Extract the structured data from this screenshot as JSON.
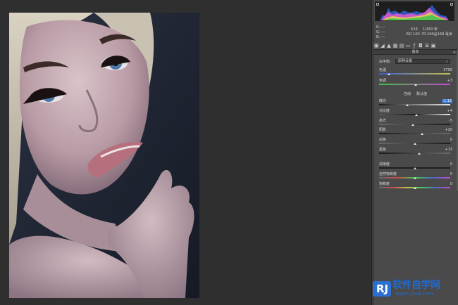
{
  "image": {
    "description_icon": "portrait-photo"
  },
  "info": {
    "r": "R:  ---",
    "g": "G:  ---",
    "b": "B:  ---",
    "aperture": "f/16",
    "shutter": "1/160 秒",
    "iso": "ISO 100",
    "lens": "70-200@168 毫米"
  },
  "toolbar": {
    "icons": [
      "aperture-icon",
      "tone-curve-icon",
      "detail-icon",
      "hsl-icon",
      "split-tone-icon",
      "lens-icon",
      "fx-icon",
      "camera-icon",
      "preset-icon",
      "snapshot-icon"
    ]
  },
  "section": {
    "title": "基本",
    "menu": "≡"
  },
  "white_balance": {
    "label": "白平衡:",
    "value": "原照设置"
  },
  "buttons": {
    "auto": "自动",
    "default": "默认值"
  },
  "sliders": [
    {
      "label": "色温",
      "value": "3700",
      "level": 0.14
    },
    {
      "label": "色调",
      "value": "+3",
      "level": 0.51
    },
    {
      "label": "曝光",
      "value": "-1.15",
      "level": 0.4,
      "highlight": true
    },
    {
      "label": "对比度",
      "value": "+4",
      "level": 0.52
    },
    {
      "label": "高光",
      "value": "-5",
      "level": 0.48
    },
    {
      "label": "阴影",
      "value": "+20",
      "level": 0.6
    },
    {
      "label": "白色",
      "value": "0",
      "level": 0.5
    },
    {
      "label": "黑色",
      "value": "+13",
      "level": 0.56
    },
    {
      "label": "清晰度",
      "value": "0",
      "level": 0.5
    },
    {
      "label": "自然饱和度",
      "value": "0",
      "level": 0.5
    },
    {
      "label": "饱和度",
      "value": "0",
      "level": 0.5
    }
  ],
  "watermark": {
    "logo": "RJ",
    "title": "软件自学网",
    "url": "www.rjzxw.com"
  },
  "colors": {
    "panel": "#4a4a4a",
    "highlight": "#3b78d6",
    "brand": "#1f6ad2"
  }
}
